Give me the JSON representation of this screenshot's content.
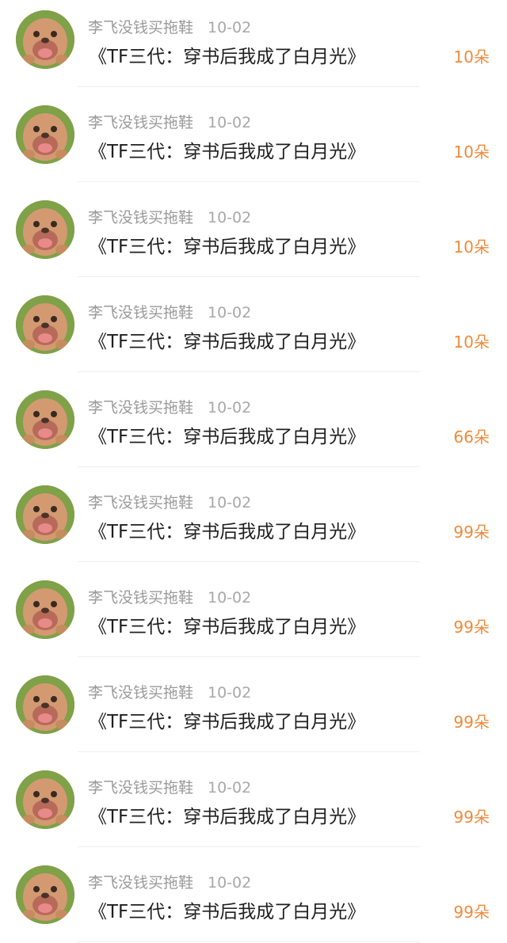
{
  "items": [
    {
      "user": "李飞没钱买拖鞋",
      "date": "10-02",
      "title": "《TF三代：穿书后我成了白月光》",
      "count": "10朵"
    },
    {
      "user": "李飞没钱买拖鞋",
      "date": "10-02",
      "title": "《TF三代：穿书后我成了白月光》",
      "count": "10朵"
    },
    {
      "user": "李飞没钱买拖鞋",
      "date": "10-02",
      "title": "《TF三代：穿书后我成了白月光》",
      "count": "10朵"
    },
    {
      "user": "李飞没钱买拖鞋",
      "date": "10-02",
      "title": "《TF三代：穿书后我成了白月光》",
      "count": "10朵"
    },
    {
      "user": "李飞没钱买拖鞋",
      "date": "10-02",
      "title": "《TF三代：穿书后我成了白月光》",
      "count": "66朵"
    },
    {
      "user": "李飞没钱买拖鞋",
      "date": "10-02",
      "title": "《TF三代：穿书后我成了白月光》",
      "count": "99朵"
    },
    {
      "user": "李飞没钱买拖鞋",
      "date": "10-02",
      "title": "《TF三代：穿书后我成了白月光》",
      "count": "99朵"
    },
    {
      "user": "李飞没钱买拖鞋",
      "date": "10-02",
      "title": "《TF三代：穿书后我成了白月光》",
      "count": "99朵"
    },
    {
      "user": "李飞没钱买拖鞋",
      "date": "10-02",
      "title": "《TF三代：穿书后我成了白月光》",
      "count": "99朵"
    },
    {
      "user": "李飞没钱买拖鞋",
      "date": "10-02",
      "title": "《TF三代：穿书后我成了白月光》",
      "count": "99朵"
    }
  ],
  "colors": {
    "count": "#f08a3a",
    "meta": "#9a9a9a",
    "title": "#1f1f1f"
  },
  "icons": {
    "avatar": "cartoon-bear-avatar"
  }
}
